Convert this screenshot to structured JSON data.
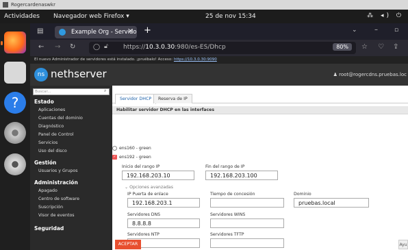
{
  "host_window": {
    "title": "Rogercardenaswkr"
  },
  "topbar": {
    "activities": "Actividades",
    "app": "Navegador web Firefox ▾",
    "clock": "25 de nov 15:34",
    "system_icons": "⁂ ◂) ⏻"
  },
  "browser": {
    "tab_title": "Example Org - Servidor",
    "new_tab": "+",
    "url_prefix": "https://",
    "url_host": "10.3.0.30",
    "url_rest": ":980/es-ES/Dhcp",
    "zoom": "80%",
    "notice_text": "El nuevo Administrador de servidores está instalado. ¡pruébalo! Acceso: ",
    "notice_link": "https://10.3.0.30:9090"
  },
  "app": {
    "logo_mark": "ns",
    "logo_text": "nethserver",
    "user": "♟ root@rogercdns.pruebas.loc"
  },
  "sidebar": {
    "search_placeholder": "Buscar...",
    "estado": "Estado",
    "estado_items": [
      "Aplicaciones",
      "Cuentas del dominio",
      "Diagnóstico",
      "Panel de Control",
      "Servicios",
      "Uso del disco"
    ],
    "gestion": "Gestión",
    "gestion_items": [
      "Usuarios y Grupos"
    ],
    "administracion": "Administración",
    "administracion_items": [
      "Apagado",
      "Centro de software",
      "Suscripción",
      "Visor de eventos"
    ],
    "seguridad": "Seguridad"
  },
  "main": {
    "tabs": [
      "Servidor DHCP",
      "Reserva de IP"
    ],
    "panel_title": "Habilitar servidor DHCP en las interfaces",
    "iface1": "ens160 - green",
    "iface2": "ens192 - green",
    "range_start_label": "Inicio del rango IP",
    "range_start_value": "192.168.203.10",
    "range_end_label": "Fin del rango de IP",
    "range_end_value": "192.168.203.100",
    "advanced": "⌄ Opciones avanzadas",
    "gateway_label": "IP Puerta de enlace",
    "gateway_value": "192.168.203.1",
    "lease_label": "Tiempo de concesión",
    "lease_value": "",
    "domain_label": "Dominio",
    "domain_value": "pruebas.local",
    "dns_label": "Servidores DNS",
    "dns_value": "8.8.8.8",
    "wins_label": "Servidores WINS",
    "wins_value": "",
    "ntp_label": "Servidores NTP",
    "ntp_value": "",
    "tftp_label": "Servidores TFTP",
    "tftp_value": "",
    "accept": "ACEPTAR",
    "help": "Ayu"
  }
}
